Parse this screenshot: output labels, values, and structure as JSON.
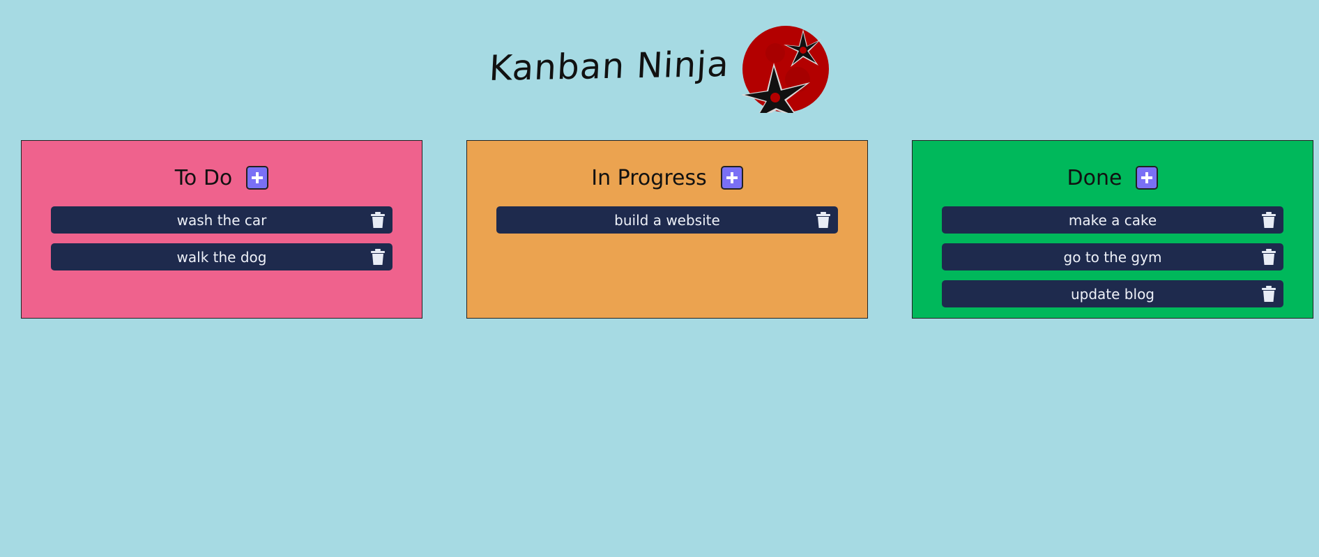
{
  "app": {
    "title": "Kanban Ninja",
    "logo_icon": "ninja-star-logo-icon"
  },
  "colors": {
    "background": "#a6dae3",
    "todo": "#ef628d",
    "in_progress": "#eba350",
    "done": "#00b85b",
    "task": "#1e2a4d",
    "add_button": "#7a70f5"
  },
  "columns": [
    {
      "title": "To Do",
      "color": "#ef628d",
      "add_icon": "plus-icon",
      "tasks": [
        {
          "text": "wash the car",
          "icon": "trash-icon"
        },
        {
          "text": "walk the dog",
          "icon": "trash-icon"
        }
      ]
    },
    {
      "title": "In Progress",
      "color": "#eba350",
      "add_icon": "plus-icon",
      "tasks": [
        {
          "text": "build a website",
          "icon": "trash-icon"
        }
      ]
    },
    {
      "title": "Done",
      "color": "#00b85b",
      "add_icon": "plus-icon",
      "tasks": [
        {
          "text": "make a cake",
          "icon": "trash-icon"
        },
        {
          "text": "go to the gym",
          "icon": "trash-icon"
        },
        {
          "text": "update blog",
          "icon": "trash-icon"
        }
      ]
    }
  ]
}
